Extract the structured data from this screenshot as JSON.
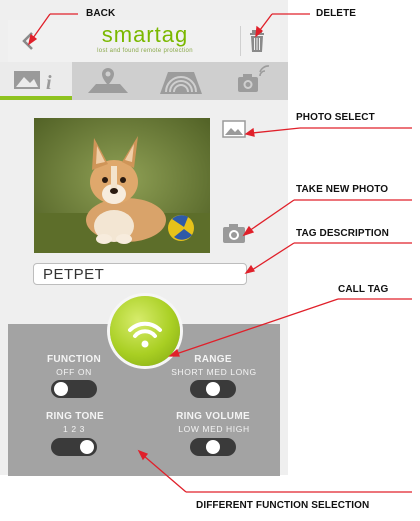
{
  "app": {
    "logo_word": "smartag",
    "logo_tagline": "lost and found remote protection"
  },
  "tabs": [
    {
      "name": "photo-info",
      "active": true
    },
    {
      "name": "location",
      "active": false
    },
    {
      "name": "range",
      "active": false
    },
    {
      "name": "camera",
      "active": false
    }
  ],
  "tag": {
    "description": "PETPET"
  },
  "panel": {
    "function": {
      "label": "FUNCTION",
      "options": "OFF   ON",
      "state": "OFF"
    },
    "range": {
      "label": "RANGE",
      "options": "SHORT MED LONG",
      "state": "MED"
    },
    "ring_tone": {
      "label": "RING TONE",
      "options": "1    2    3",
      "state": "3"
    },
    "ring_volume": {
      "label": "RING VOLUME",
      "options": "LOW  MED   HIGH",
      "state": "MED"
    }
  },
  "callouts": {
    "back": "BACK",
    "delete": "DELETE",
    "photo_select": "PHOTO SELECT",
    "take_new_photo": "TAKE NEW PHOTO",
    "tag_description": "TAG DESCRIPTION",
    "call_tag": "CALL TAG",
    "different_function": "DIFFERENT FUNCTION SELECTION"
  },
  "colors": {
    "accent_green": "#8ec21f",
    "panel_gray": "#a3a3a3",
    "callout_red": "#e0202a"
  }
}
